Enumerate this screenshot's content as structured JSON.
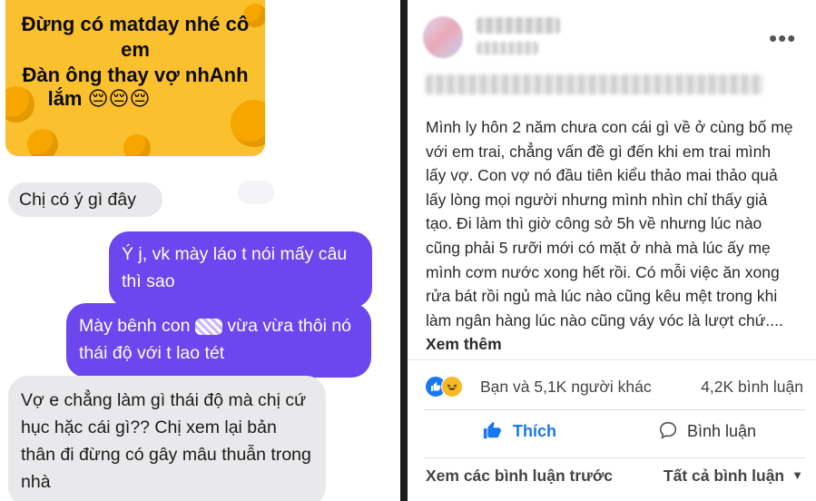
{
  "chat": {
    "sticker": {
      "line1": "Đừng có matday nhé cô",
      "line2": "em",
      "line3": "Đàn ông thay vợ nhAnh",
      "line4": "lắm 😔😔😔"
    },
    "messages": [
      {
        "sender": "other",
        "text": "Chị có ý gì đây"
      },
      {
        "sender": "me",
        "text": "Ý j, vk mày láo t nói mấy câu thì sao"
      },
      {
        "sender": "me",
        "text_before": "Mày bênh con",
        "text_after": "vừa vừa thôi nó thái độ với t lao tét"
      },
      {
        "sender": "other",
        "text": "Vợ e chẳng làm gì thái độ mà chị cứ hục hặc cái gì?? Chị xem lại bản thân đi đừng có gây mâu thuẫn trong nhà"
      }
    ],
    "colors": {
      "me_bubble": "#6c46ee",
      "other_bubble": "#e9e9eb"
    }
  },
  "post": {
    "more_icon": "•••",
    "body": "Mình ly hôn 2 năm chưa con cái gì về ở cùng bố mẹ với em trai, chẳng vấn đề gì đến khi em trai mình lấy vợ. Con vợ nó đầu tiên kiểu thảo mai thảo quả lấy lòng mọi người nhưng mình nhìn chỉ thấy giả tạo. Đi làm thì giờ công sở 5h về nhưng lúc nào cũng phải 5 rưỡi mới có mặt ở nhà mà lúc ấy mẹ mình cơm nước xong hết rồi. Có mỗi việc ăn xong rửa bát rồi ngủ mà lúc nào cũng kêu mệt trong khi làm ngân hàng lúc nào cũng váy vóc là lượt chứ....",
    "see_more": "Xem thêm",
    "reactions_text": "Bạn và 5,1K người khác",
    "comments_count": "4,2K bình luận",
    "like_label": "Thích",
    "comment_label": "Bình luận",
    "view_previous": "Xem các bình luận trước",
    "all_comments": "Tất cả bình luận",
    "colors": {
      "accent": "#1877f2"
    }
  }
}
